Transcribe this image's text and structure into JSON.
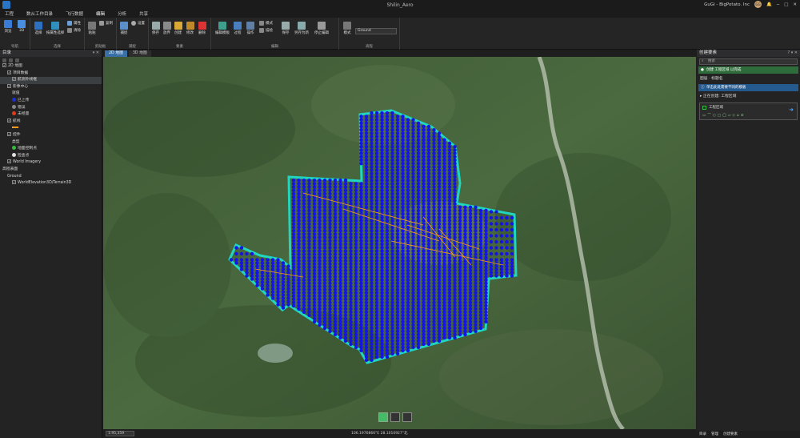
{
  "window": {
    "title": "Shilin_Aero",
    "user": "GuGi - BigPotato. Inc",
    "avatar_text": "GG"
  },
  "menu": [
    "工程",
    "数从工作目录",
    "飞行数据",
    "编辑",
    "分析",
    "共享"
  ],
  "ribbon": {
    "groups": [
      {
        "label": "导航",
        "buttons": [
          "浏览",
          "3D"
        ]
      },
      {
        "label": "选择",
        "buttons": [
          "选择",
          "按属性选择",
          "属性",
          "清除"
        ]
      },
      {
        "label": "剪贴板",
        "buttons": [
          "粘贴",
          "复制"
        ]
      },
      {
        "label": "捕捉",
        "buttons": [
          "捕捉",
          "设置"
        ]
      },
      {
        "label": "要素",
        "buttons": [
          "保存",
          "放弃",
          "创建",
          "修改",
          "删除"
        ]
      },
      {
        "label": "编辑",
        "buttons": [
          "编辑模板",
          "过程",
          "操作",
          "模式",
          "描绘",
          "保存",
          "另存为新",
          "停止编辑"
        ]
      },
      {
        "label": "高程",
        "buttons": [
          "模式"
        ]
      }
    ],
    "elevation_value": "Ground"
  },
  "contents": {
    "title": "目录",
    "items": [
      {
        "label": "2D 地图",
        "indent": 0,
        "checked": true
      },
      {
        "label": "项目数据",
        "indent": 1,
        "checked": true
      },
      {
        "label": "航测外线框",
        "indent": 2,
        "checked": true,
        "selected": true
      },
      {
        "label": "影像中心",
        "indent": 1,
        "checked": true
      },
      {
        "label": "就值",
        "indent": 2,
        "checked": null
      },
      {
        "label": "已上传",
        "indent": 2,
        "symbol": "#1a2fd6"
      },
      {
        "label": "错误",
        "indent": 2,
        "symbol": "#888888"
      },
      {
        "label": "未经量",
        "indent": 2,
        "symbol": "#e23a1a"
      },
      {
        "label": "航线",
        "indent": 1,
        "checked": true
      },
      {
        "label": "",
        "indent": 2,
        "line": "#ff9a1a"
      },
      {
        "label": "控件",
        "indent": 1,
        "checked": true
      },
      {
        "label": "类型",
        "indent": 2,
        "checked": null
      },
      {
        "label": "地面控制点",
        "indent": 2,
        "symbol": "#2fbf3a"
      },
      {
        "label": "检查点",
        "indent": 2,
        "symbol": "#e0e0e0"
      },
      {
        "label": "World Imagery",
        "indent": 1,
        "checked": true
      },
      {
        "label": "高程表面",
        "indent": 0,
        "checked": null
      },
      {
        "label": "Ground",
        "indent": 1,
        "checked": null
      },
      {
        "label": "WorldElevation3D/Terrain3D",
        "indent": 2,
        "checked": true
      }
    ]
  },
  "map": {
    "tabs": [
      "2D 地图",
      "3D 地图"
    ],
    "scale": "1:95,359",
    "coords": "106.1976866°E 28.1010927°北",
    "colors": {
      "boundary": "#20d6c0",
      "points": "#1414e6",
      "flightline": "#ff9a1a"
    }
  },
  "create_features": {
    "title": "创建要素",
    "search_placeholder": "搜索",
    "green_notice": "创建 工程区域 以完成",
    "tab_row": "图层 · 标题名",
    "blue_notice": "单击此处需要不同的模板",
    "section": "▸ 正在创建: 工程区域",
    "template_name": "工程区域",
    "bottom_tabs": [
      "目录",
      "管理",
      "创建要素"
    ]
  }
}
